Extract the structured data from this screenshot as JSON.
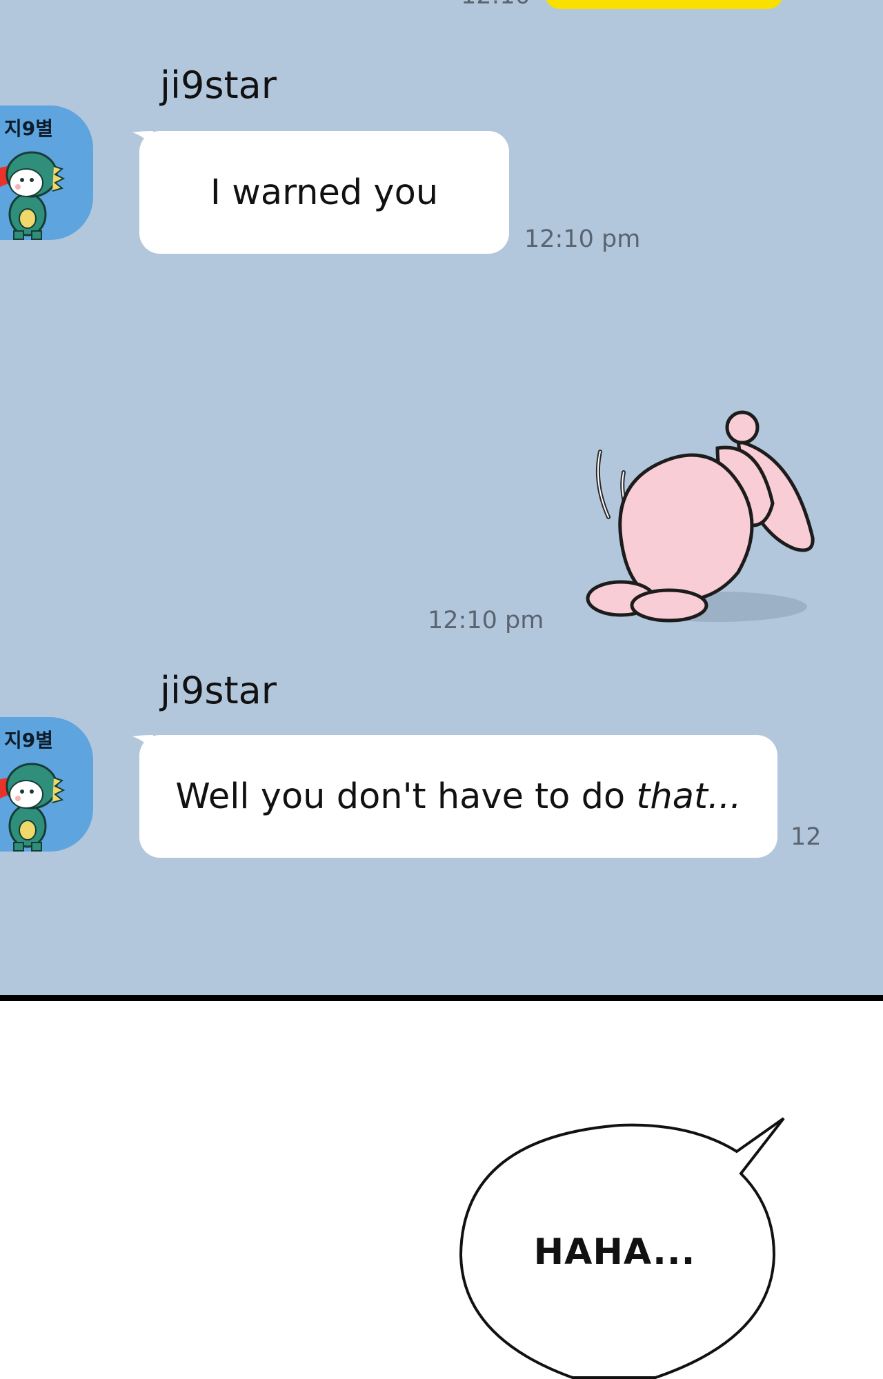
{
  "chat": {
    "top_time": "12:10",
    "messages": [
      {
        "sender": "ji9star",
        "avatar_label": "지9별",
        "text": "I warned you",
        "time": "12:10 pm"
      },
      {
        "type": "sticker",
        "sticker_name": "pink-bunny-bowing-sticker",
        "time": "12:10 pm"
      },
      {
        "sender": "ji9star",
        "avatar_label": "지9별",
        "text_plain": "Well you don't have to do ",
        "text_emphasis": "that...",
        "time": "12"
      }
    ]
  },
  "comic": {
    "balloon_text": "HAHA..."
  },
  "colors": {
    "chat_background": "#b3c7dc",
    "my_bubble": "#f9e000",
    "their_bubble": "#ffffff",
    "avatar_bg": "#5ea4de",
    "divider": "#000000"
  }
}
